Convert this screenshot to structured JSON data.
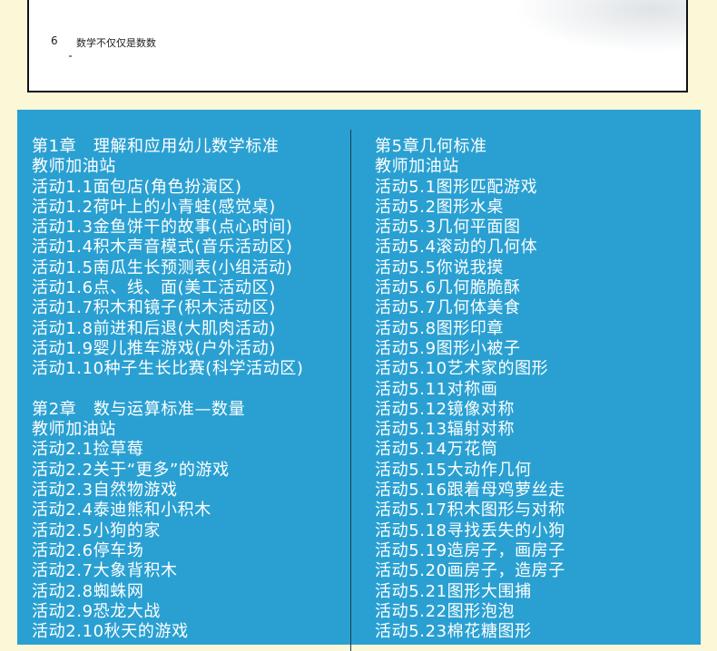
{
  "book_page": {
    "page_number": "6",
    "heading": "数学不仅仅是数数"
  },
  "toc": {
    "left_column": [
      "第1章　理解和应用幼儿数学标准",
      "教师加油站",
      "活动1.1面包店(角色扮演区)",
      "活动1.2荷叶上的小青蛙(感觉桌)",
      "活动1.3金鱼饼干的故事(点心时间)",
      "活动1.4积木声音模式(音乐活动区)",
      "活动1.5南瓜生长预测表(小组活动)",
      "活动1.6点、线、面(美工活动区)",
      "活动1.7积木和镜子(积木活动区)",
      "活动1.8前进和后退(大肌肉活动)",
      "活动1.9婴儿推车游戏(户外活动)",
      "活动1.10种子生长比赛(科学活动区)",
      "",
      "第2章　数与运算标准—数量",
      "教师加油站",
      "活动2.1捡草莓",
      "活动2.2关于“更多”的游戏",
      "活动2.3自然物游戏",
      "活动2.4泰迪熊和小积木",
      "活动2.5小狗的家",
      "活动2.6停车场",
      "活动2.7大象背积木",
      "活动2.8蜘蛛网",
      "活动2.9恐龙大战",
      "活动2.10秋天的游戏"
    ],
    "right_column": [
      "第5章几何标准",
      "教师加油站",
      "活动5.1图形匹配游戏",
      "活动5.2图形水桌",
      "活动5.3几何平面图",
      "活动5.4滚动的几何体",
      "活动5.5你说我摸",
      "活动5.6几何脆脆酥",
      "活动5.7几何体美食",
      "活动5.8图形印章",
      "活动5.9图形小被子",
      "活动5.10艺术家的图形",
      "活动5.11对称画",
      "活动5.12镜像对称",
      "活动5.13辐射对称",
      "活动5.14万花筒",
      "活动5.15大动作几何",
      "活动5.16跟着母鸡萝丝走",
      "活动5.17积木图形与对称",
      "活动5.18寻找丢失的小狗",
      "活动5.19造房子，画房子",
      "活动5.20画房子，造房子",
      "活动5.21图形大围捕",
      "活动5.22图形泡泡",
      "活动5.23棉花糖图形"
    ]
  }
}
